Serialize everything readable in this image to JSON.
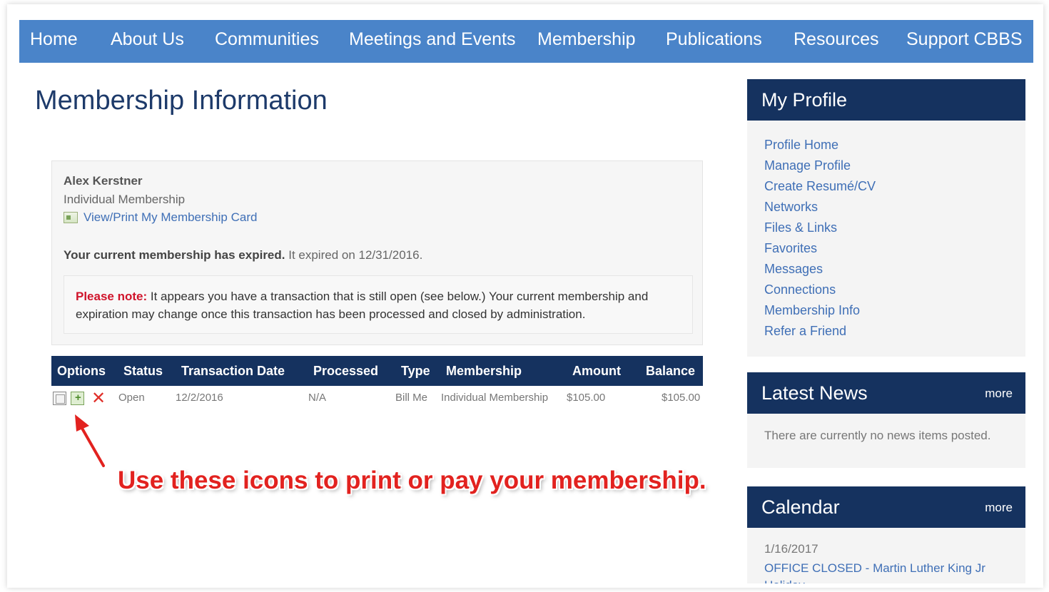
{
  "nav": {
    "items": [
      "Home",
      "About Us",
      "Communities",
      "Meetings and Events",
      "Membership",
      "Publications",
      "Resources",
      "Support CBBS"
    ]
  },
  "page": {
    "title": "Membership Information"
  },
  "member": {
    "name": "Alex Kerstner",
    "type": "Individual Membership",
    "card_link": "View/Print My Membership Card",
    "expired_bold": "Your current membership has expired.",
    "expired_rest": " It expired on 12/31/2016.",
    "note_label": "Please note:",
    "note_text": " It appears you have a transaction that is still open (see below.) Your current membership and expiration may change once this transaction has been processed and closed by administration."
  },
  "transactions": {
    "headers": [
      "Options",
      "Status",
      "Transaction Date",
      "Processed",
      "Type",
      "Membership",
      "Amount",
      "Balance"
    ],
    "rows": [
      {
        "status": "Open",
        "date": "12/2/2016",
        "processed": "N/A",
        "type": "Bill Me",
        "membership": "Individual Membership",
        "amount": "$105.00",
        "balance": "$105.00"
      }
    ]
  },
  "annotation": {
    "text": "Use these icons to print or pay your membership."
  },
  "sidebar": {
    "profile": {
      "title": "My Profile",
      "links": [
        "Profile Home",
        "Manage Profile",
        "Create Resumé/CV",
        "Networks",
        "Files & Links",
        "Favorites",
        "Messages",
        "Connections",
        "Membership Info",
        "Refer a Friend"
      ]
    },
    "news": {
      "title": "Latest News",
      "more": "more",
      "text": "There are currently no news items posted."
    },
    "calendar": {
      "title": "Calendar",
      "more": "more",
      "date": "1/16/2017",
      "event": "OFFICE CLOSED - Martin Luther King Jr Holiday"
    }
  },
  "colors": {
    "nav": "#4a84c9",
    "header_dark": "#15325f",
    "link": "#3f6fb6",
    "alert": "#d0142b"
  }
}
